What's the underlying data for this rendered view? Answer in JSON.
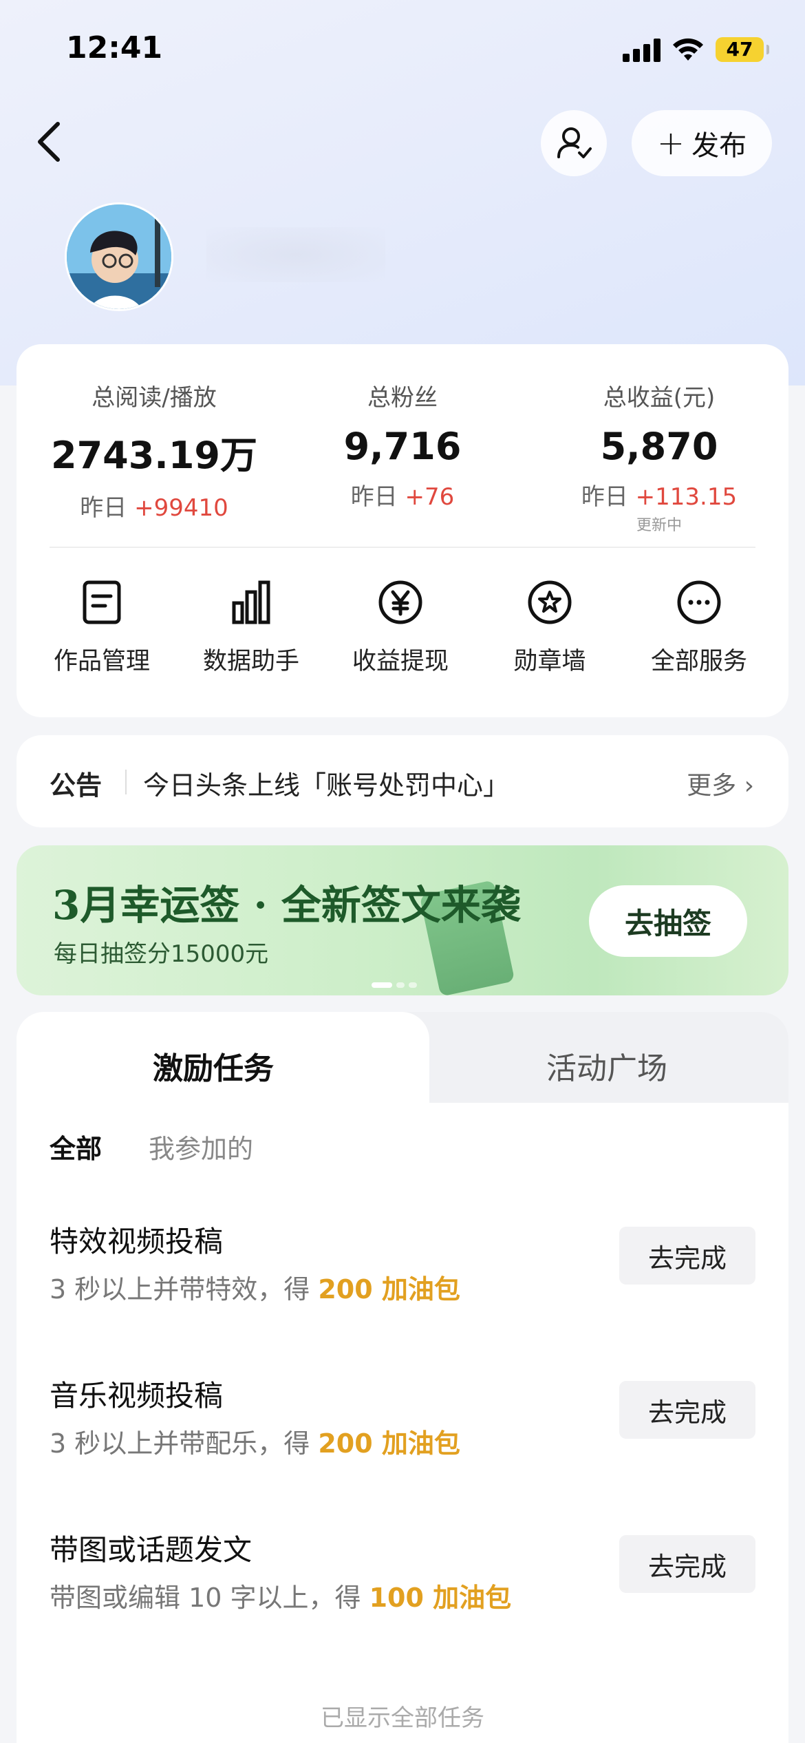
{
  "status_bar": {
    "time": "12:41",
    "battery": "47"
  },
  "header": {
    "publish_label": "发布"
  },
  "stats": [
    {
      "label": "总阅读/播放",
      "value": "2743.19万",
      "delta_prefix": "昨日 ",
      "delta": "+99410",
      "note": ""
    },
    {
      "label": "总粉丝",
      "value": "9,716",
      "delta_prefix": "昨日 ",
      "delta": "+76",
      "note": ""
    },
    {
      "label": "总收益(元)",
      "value": "5,870",
      "delta_prefix": "昨日 ",
      "delta": "+113.15",
      "note": "更新中"
    }
  ],
  "shortcuts": [
    {
      "label": "作品管理",
      "icon": "document-icon"
    },
    {
      "label": "数据助手",
      "icon": "bar-chart-icon"
    },
    {
      "label": "收益提现",
      "icon": "yuan-icon"
    },
    {
      "label": "勋章墙",
      "icon": "medal-icon"
    },
    {
      "label": "全部服务",
      "icon": "more-icon"
    }
  ],
  "notice": {
    "title": "公告",
    "text": "今日头条上线「账号处罚中心」",
    "more": "更多"
  },
  "banner": {
    "title": "3月幸运签 · 全新签文来袭",
    "subtitle": "每日抽签分15000元",
    "button": "去抽签",
    "accent": "#1e5a2a"
  },
  "tabs": {
    "active": "激励任务",
    "inactive": "活动广场"
  },
  "filters": {
    "all": "全部",
    "joined": "我参加的"
  },
  "tasks": [
    {
      "title": "特效视频投稿",
      "desc": "3 秒以上并带特效，得 ",
      "reward": "200 加油包",
      "button": "去完成"
    },
    {
      "title": "音乐视频投稿",
      "desc": "3 秒以上并带配乐，得 ",
      "reward": "200 加油包",
      "button": "去完成"
    },
    {
      "title": "带图或话题发文",
      "desc": "带图或编辑 10 字以上，得 ",
      "reward": "100 加油包",
      "button": "去完成"
    }
  ],
  "footer": "已显示全部任务",
  "colors": {
    "delta": "#e0483e",
    "reward": "#e2a020"
  }
}
